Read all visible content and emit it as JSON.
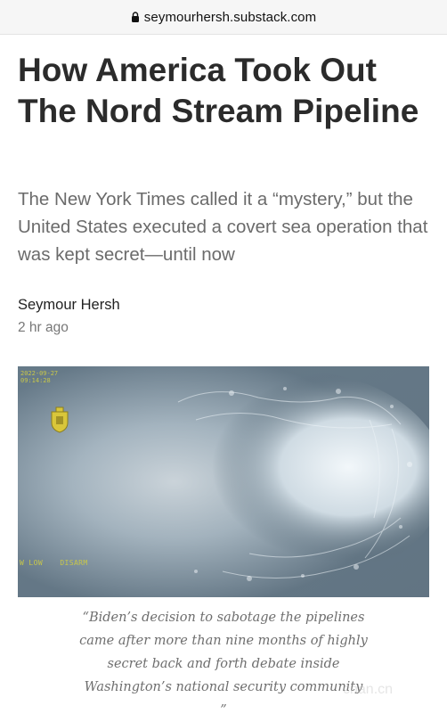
{
  "browser": {
    "url": "seymourhersh.substack.com",
    "lock_icon": "lock-icon"
  },
  "article": {
    "title": "How America Took Out The Nord Stream Pipeline",
    "subtitle": "The New York Times called it a “mystery,” but the United States executed a covert sea operation that was kept secret—until now",
    "author": "Seymour Hersh",
    "time": "2 hr ago"
  },
  "image": {
    "hud_top_line1": "2022-09-27",
    "hud_top_line2": "09:14:28",
    "hud_left": "W LOW",
    "hud_right": "DISARM",
    "badge_icon": "coat-of-arms-icon"
  },
  "quote": {
    "line1": "“Biden’s decision to sabotage the pipelines",
    "line2": "came after more than nine months of highly",
    "line3": "secret back and forth debate inside",
    "line4": "Washington’s national security community",
    "line5": "”"
  },
  "watermark": "chan.cn"
}
